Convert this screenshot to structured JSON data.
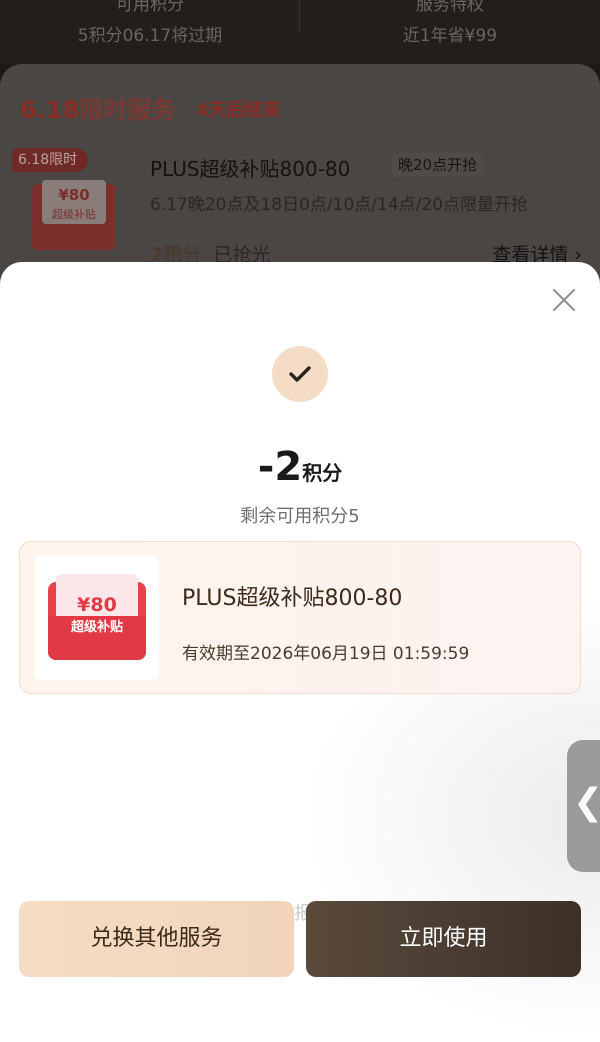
{
  "background": {
    "top_left_label": "可用积分",
    "top_left_sub": "5积分06.17将过期",
    "top_right_label": "服务特权",
    "top_right_sub": "近1年省¥99",
    "section_title_red": "6.18",
    "section_title": "限时服务",
    "section_countdown": "4天后结束",
    "card_tag": "6.18限时",
    "card_thumb_amount": "¥80",
    "card_thumb_label": "超级补贴",
    "card_title": "PLUS超级补贴800-80",
    "card_badge": "晚20点开抢",
    "card_desc": "6.17晚20点及18日0点/10点/14点/20点限量开抢",
    "card_points": "2积分",
    "card_status": "已抢光",
    "card_detail": "查看详情 ›"
  },
  "sheet": {
    "deduct_number": "-2",
    "deduct_unit": "积分",
    "remaining_text": "剩余可用积分5",
    "voucher": {
      "thumb_amount": "¥80",
      "thumb_label": "超级补贴",
      "title": "PLUS超级补贴800-80",
      "validity": "有效期至2026年06月19日 01:59:59"
    },
    "button_other": "兑换其他服务",
    "button_use": "立即使用",
    "watermark": "线报酷-new.xianbao.fun",
    "side_handle": "❮"
  },
  "colors": {
    "accent_peach": "#f5dcc4",
    "button_dark": "#4a3c30",
    "voucher_red": "#e23a44"
  }
}
